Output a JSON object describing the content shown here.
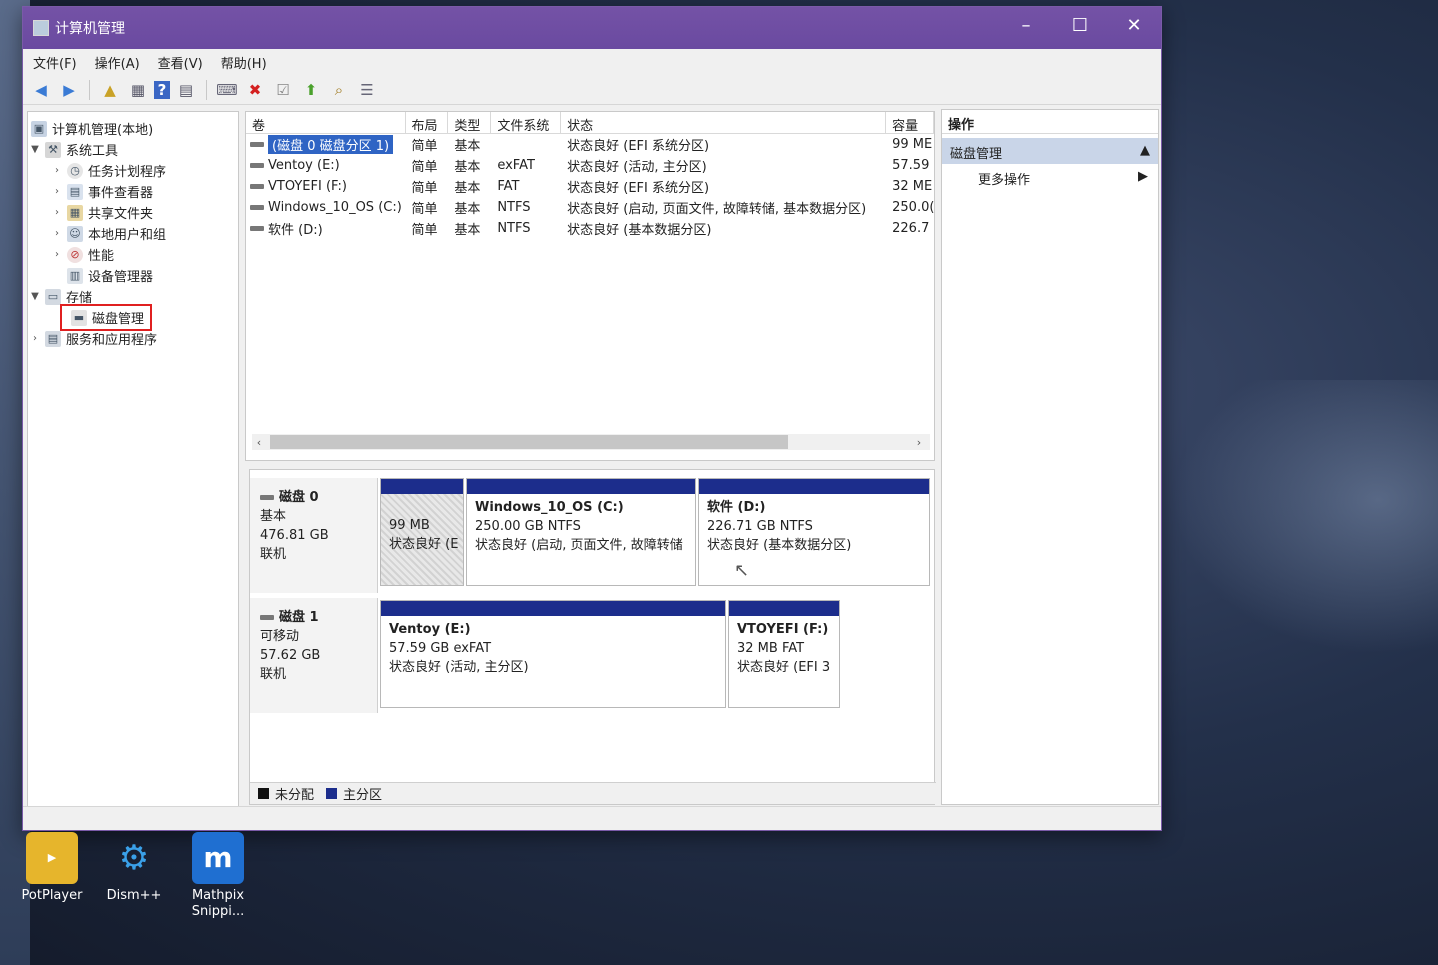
{
  "window": {
    "title": "计算机管理",
    "controls": {
      "minimize": "–",
      "maximize": "☐",
      "close": "✕"
    }
  },
  "menu": [
    "文件(F)",
    "操作(A)",
    "查看(V)",
    "帮助(H)"
  ],
  "toolbar_icons": [
    "back-icon",
    "forward-icon",
    "up-folder-icon",
    "show-hide-tree-icon",
    "help-icon",
    "panel-icon",
    "connect-icon",
    "delete-icon",
    "check-icon",
    "import-icon",
    "search-icon",
    "properties-icon"
  ],
  "tree": {
    "root": "计算机管理(本地)",
    "system_tools": "系统工具",
    "children": [
      "任务计划程序",
      "事件查看器",
      "共享文件夹",
      "本地用户和组",
      "性能",
      "设备管理器"
    ],
    "storage": "存储",
    "disk_management": "磁盘管理",
    "services": "服务和应用程序"
  },
  "volumes": {
    "columns": [
      "卷",
      "布局",
      "类型",
      "文件系统",
      "状态",
      "容量"
    ],
    "rows": [
      {
        "name": "(磁盘 0 磁盘分区 1)",
        "layout": "简单",
        "type": "基本",
        "fs": "",
        "status": "状态良好 (EFI 系统分区)",
        "capacity": "99 ME"
      },
      {
        "name": "Ventoy (E:)",
        "layout": "简单",
        "type": "基本",
        "fs": "exFAT",
        "status": "状态良好 (活动, 主分区)",
        "capacity": "57.59"
      },
      {
        "name": "VTOYEFI (F:)",
        "layout": "简单",
        "type": "基本",
        "fs": "FAT",
        "status": "状态良好 (EFI 系统分区)",
        "capacity": "32 ME"
      },
      {
        "name": "Windows_10_OS (C:)",
        "layout": "简单",
        "type": "基本",
        "fs": "NTFS",
        "status": "状态良好 (启动, 页面文件, 故障转储, 基本数据分区)",
        "capacity": "250.0("
      },
      {
        "name": "软件 (D:)",
        "layout": "简单",
        "type": "基本",
        "fs": "NTFS",
        "status": "状态良好 (基本数据分区)",
        "capacity": "226.7"
      }
    ]
  },
  "disks": {
    "disk0": {
      "name": "磁盘 0",
      "kind": "基本",
      "size": "476.81 GB",
      "state": "联机",
      "p1": {
        "size": "99 MB",
        "status": "状态良好 (E"
      },
      "p2": {
        "title": "Windows_10_OS  (C:)",
        "size": "250.00 GB NTFS",
        "status": "状态良好 (启动, 页面文件, 故障转储"
      },
      "p3": {
        "title": "软件  (D:)",
        "size": "226.71 GB NTFS",
        "status": "状态良好 (基本数据分区)"
      }
    },
    "disk1": {
      "name": "磁盘 1",
      "kind": "可移动",
      "size": "57.62 GB",
      "state": "联机",
      "p1": {
        "title": "Ventoy  (E:)",
        "size": "57.59 GB exFAT",
        "status": "状态良好 (活动, 主分区)"
      },
      "p2": {
        "title": "VTOYEFI  (F:)",
        "size": "32 MB FAT",
        "status": "状态良好 (EFI 3"
      }
    }
  },
  "legend": {
    "unallocated": "未分配",
    "primary": "主分区"
  },
  "actions": {
    "header": "操作",
    "section": "磁盘管理",
    "more": "更多操作"
  },
  "desktop": [
    {
      "label": "PotPlayer"
    },
    {
      "label": "Dism++"
    },
    {
      "label": "Mathpix Snippi..."
    }
  ],
  "colors": {
    "titlebar": "#6a4aa0",
    "partition_bar": "#1c2d8c",
    "selection": "#2f64c4",
    "unallocated": "#111111",
    "primary": "#1c2d8c"
  }
}
